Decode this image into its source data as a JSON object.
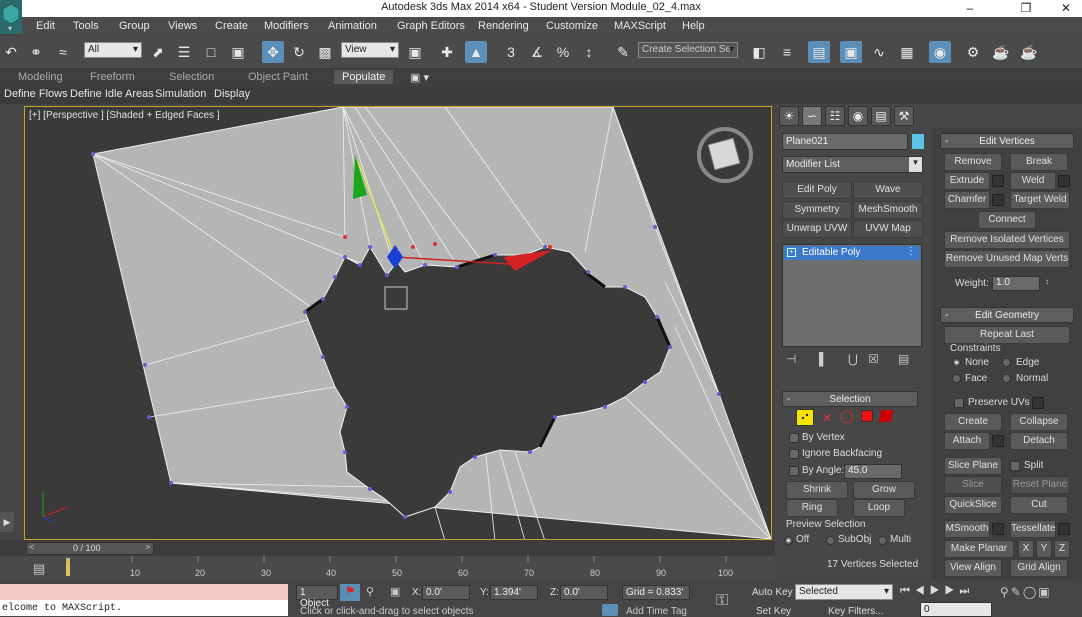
{
  "window": {
    "title": "Autodesk 3ds Max  2014 x64  -  Student Version    Module_02_4.max"
  },
  "menu": [
    "Edit",
    "Tools",
    "Group",
    "Views",
    "Create",
    "Modifiers",
    "Animation",
    "Graph Editors",
    "Rendering",
    "Customize",
    "MAXScript",
    "Help"
  ],
  "toolbar": {
    "selection_filter": "All",
    "ref_coord": "View",
    "named_selection": "Create Selection Se"
  },
  "ribbon": {
    "tabs": [
      "Modeling",
      "Freeform",
      "Selection",
      "Object Paint",
      "Populate"
    ],
    "selected": "Populate",
    "subtabs": [
      "Define Flows",
      "Define Idle Areas",
      "Simulation",
      "Display"
    ]
  },
  "viewport": {
    "label": "[+] [Perspective ] [Shaded + Edged Faces ]"
  },
  "command_panel": {
    "object_name": "Plane021",
    "object_color": "#5bc3e6",
    "modifier_list": "Modifier List",
    "modifier_buttons": [
      "Edit Poly",
      "Wave",
      "Symmetry",
      "MeshSmooth",
      "Unwrap UVW",
      "UVW Map"
    ],
    "stack_item": "Editable Poly",
    "selection": {
      "title": "Selection",
      "by_vertex": "By Vertex",
      "ignore_backfacing": "Ignore Backfacing",
      "by_angle": "By Angle:",
      "angle_value": "45.0",
      "shrink": "Shrink",
      "grow": "Grow",
      "ring": "Ring",
      "loop": "Loop",
      "preview_title": "Preview Selection",
      "preview_options": [
        "Off",
        "SubObj",
        "Multi"
      ],
      "status": "17 Vertices Selected"
    },
    "edit_vertices": {
      "title": "Edit Vertices",
      "buttons": [
        "Remove",
        "Break",
        "Extrude",
        "Weld",
        "Chamfer",
        "Target Weld",
        "Connect",
        "Remove Isolated Vertices",
        "Remove Unused Map Verts"
      ],
      "weight_label": "Weight:",
      "weight_value": "1.0"
    },
    "edit_geometry": {
      "title": "Edit Geometry",
      "repeat_last": "Repeat Last",
      "constraints_title": "Constraints",
      "constraints": [
        "None",
        "Edge",
        "Face",
        "Normal"
      ],
      "preserve_uvs": "Preserve UVs",
      "buttons": [
        "Create",
        "Collapse",
        "Attach",
        "Detach",
        "Slice Plane",
        "Split",
        "Slice",
        "Reset Plane",
        "QuickSlice",
        "Cut",
        "MSmooth",
        "Tessellate",
        "Make Planar",
        "X",
        "Y",
        "Z",
        "View Align",
        "Grid Align"
      ]
    }
  },
  "timeline": {
    "frame": "0 / 100",
    "ticks": [
      "10",
      "20",
      "30",
      "40",
      "50",
      "60",
      "70",
      "80",
      "90",
      "100"
    ]
  },
  "status": {
    "maxscript": "elcome to MAXScript.",
    "objects": "1 Object",
    "x_label": "X:",
    "x": "0.0'",
    "y_label": "Y:",
    "y": "1.394'",
    "z_label": "Z:",
    "z": "0.0'",
    "grid": "Grid = 0.833'",
    "prompt": "Click or click-and-drag to select objects",
    "add_time_tag": "Add Time Tag",
    "auto_key": "Auto Key",
    "set_key": "Set Key",
    "key_mode": "Selected",
    "key_filters": "Key Filters...",
    "current_frame": "0"
  }
}
